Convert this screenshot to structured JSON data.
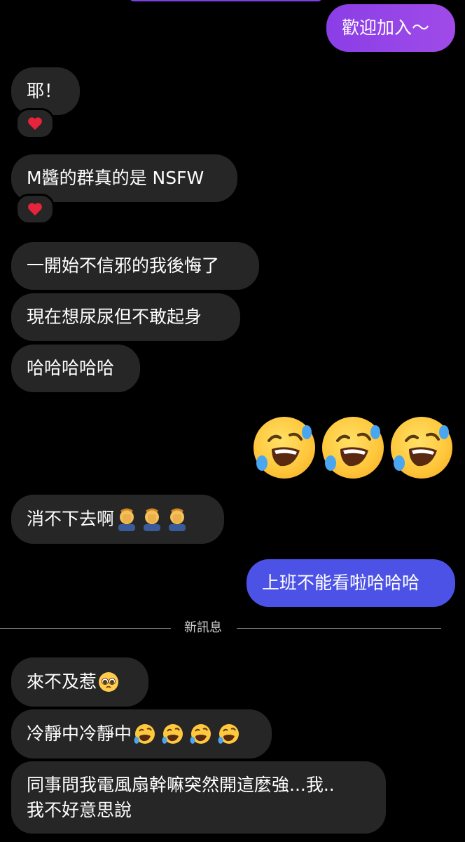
{
  "colors": {
    "background": "#000000",
    "received_bubble": "#262626",
    "sent_purple": "#9644e7",
    "sent_blue": "#4d52e6"
  },
  "messages": {
    "m1": "歡迎加入～",
    "m2": "耶！",
    "m3": "M醬的群真的是 NSFW",
    "m4": "一開始不信邪的我後悔了",
    "m5": "現在想尿尿但不敢起身",
    "m6": "哈哈哈哈哈",
    "m7": "消不下去啊",
    "m8": "上班不能看啦哈哈哈",
    "m9": "來不及惹",
    "m10": "冷靜中冷靜中",
    "m11_line1": "同事問我電風扇幹嘛突然開這麼強...我..",
    "m11_line2": "我不好意思說"
  },
  "reactions": {
    "m2": "heart-icon",
    "m3": "heart-icon"
  },
  "divider": {
    "label": "新訊息"
  },
  "emojis": {
    "sent_big": [
      "rofl-emoji",
      "rofl-emoji",
      "rofl-emoji"
    ],
    "m7": [
      "facepalm-emoji",
      "facepalm-emoji",
      "facepalm-emoji"
    ],
    "m9": [
      "pleading-face-emoji"
    ],
    "m10": [
      "rofl-emoji",
      "rofl-emoji",
      "rofl-emoji",
      "rofl-emoji"
    ]
  }
}
